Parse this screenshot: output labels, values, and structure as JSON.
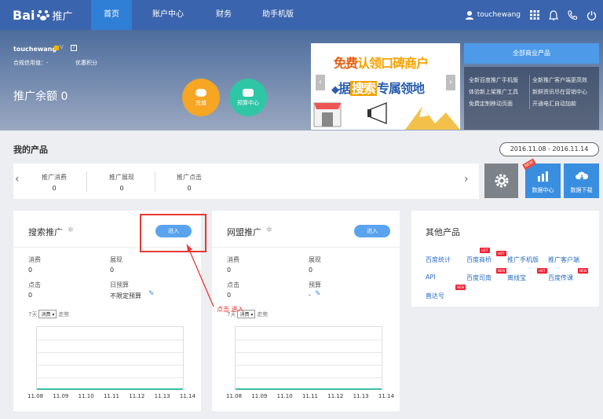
{
  "header": {
    "logo_text": "Bai",
    "logo_suffix": "推广",
    "nav": [
      "首页",
      "账户中心",
      "财务",
      "助手机版"
    ],
    "username": "touchewang"
  },
  "hero": {
    "username": "touchewang",
    "credit_label": "合规信用值：-",
    "points_label": "优惠积分",
    "balance": "推广余额 0",
    "recharge": "充值",
    "budget_center": "预算中心",
    "banner_line1_a": "免费",
    "banner_line1_b": "认领口碑商户",
    "banner_line2_a": "据",
    "banner_line2_b": "搜索",
    "banner_line2_c": "专属领地",
    "all_products": "全部商业产品",
    "links": [
      "全新百度推广手机版",
      "全新推广客户端更高效",
      "体验新上架推广工具",
      "新鲜资讯尽在营销中心",
      "免费定制移动页面",
      "开通电汇自动加款"
    ]
  },
  "products": {
    "title": "我的产品",
    "date_range": "2016.11.08 - 2016.11.14",
    "stats": [
      {
        "label": "推广消费",
        "value": "0"
      },
      {
        "label": "推广展现",
        "value": "0"
      },
      {
        "label": "推广点击",
        "value": "0"
      }
    ],
    "data_center": "数据中心",
    "data_download": "数据下载",
    "new_badge": "NEW"
  },
  "search_card": {
    "title": "搜索推广",
    "enter": "进入",
    "cost_label": "消费",
    "cost": "0",
    "show_label": "展现",
    "show": "0",
    "click_label": "点击",
    "click": "0",
    "budget_label": "日预算",
    "budget": "不限定预算",
    "trend_pre": "7天",
    "trend_sel": "消费",
    "trend_post": "走势",
    "xticks": [
      "11.08",
      "11.09",
      "11.10",
      "11.11",
      "11.12",
      "11.13",
      "11.14"
    ]
  },
  "union_card": {
    "title": "网盟推广",
    "enter": "进入",
    "cost_label": "消费",
    "cost": "0",
    "show_label": "展现",
    "show": "0",
    "click_label": "点击",
    "click": "0",
    "budget_label": "预算",
    "budget": "-",
    "trend_pre": "7天",
    "trend_sel": "消费",
    "trend_post": "走势",
    "xticks": [
      "11.08",
      "11.09",
      "11.10",
      "11.11",
      "11.12",
      "11.13",
      "11.14"
    ]
  },
  "other": {
    "title": "其他产品",
    "items": [
      "百度统计",
      "百度商桥",
      "推广手机版",
      "推广客户端",
      "API",
      "百度司南",
      "离线宝",
      "百度传课",
      "直达号"
    ],
    "hot": "HOT",
    "new": "NEW"
  },
  "annotation": "点击 进入"
}
